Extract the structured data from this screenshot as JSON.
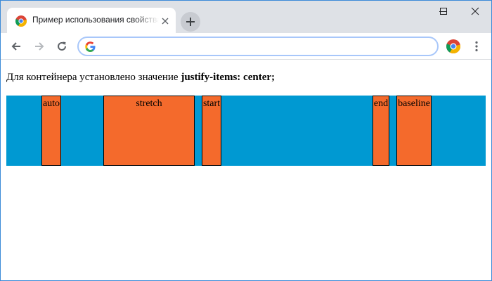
{
  "browser": {
    "tab": {
      "title": "Пример использования свойства justify-items",
      "close_icon": "close-icon",
      "favicon": "chrome-logo-icon"
    },
    "new_tab_icon": "plus-icon",
    "window_controls": [
      "minimize-icon",
      "maximize-icon",
      "close-icon"
    ],
    "toolbar": {
      "back_icon": "arrow-left-icon",
      "forward_icon": "arrow-right-icon",
      "reload_icon": "reload-icon",
      "address_value": "",
      "address_icon": "google-g-icon",
      "profile_icon": "profile-icon",
      "menu_icon": "kebab-menu-icon"
    }
  },
  "page": {
    "description_prefix": "Для контейнера установлено значение ",
    "description_code": "justify-items: center;",
    "grid_items": [
      "auto",
      "stretch",
      "start",
      "end",
      "baseline"
    ]
  },
  "colors": {
    "grid_background": "#0099d2",
    "item_background": "#f46a2c"
  }
}
